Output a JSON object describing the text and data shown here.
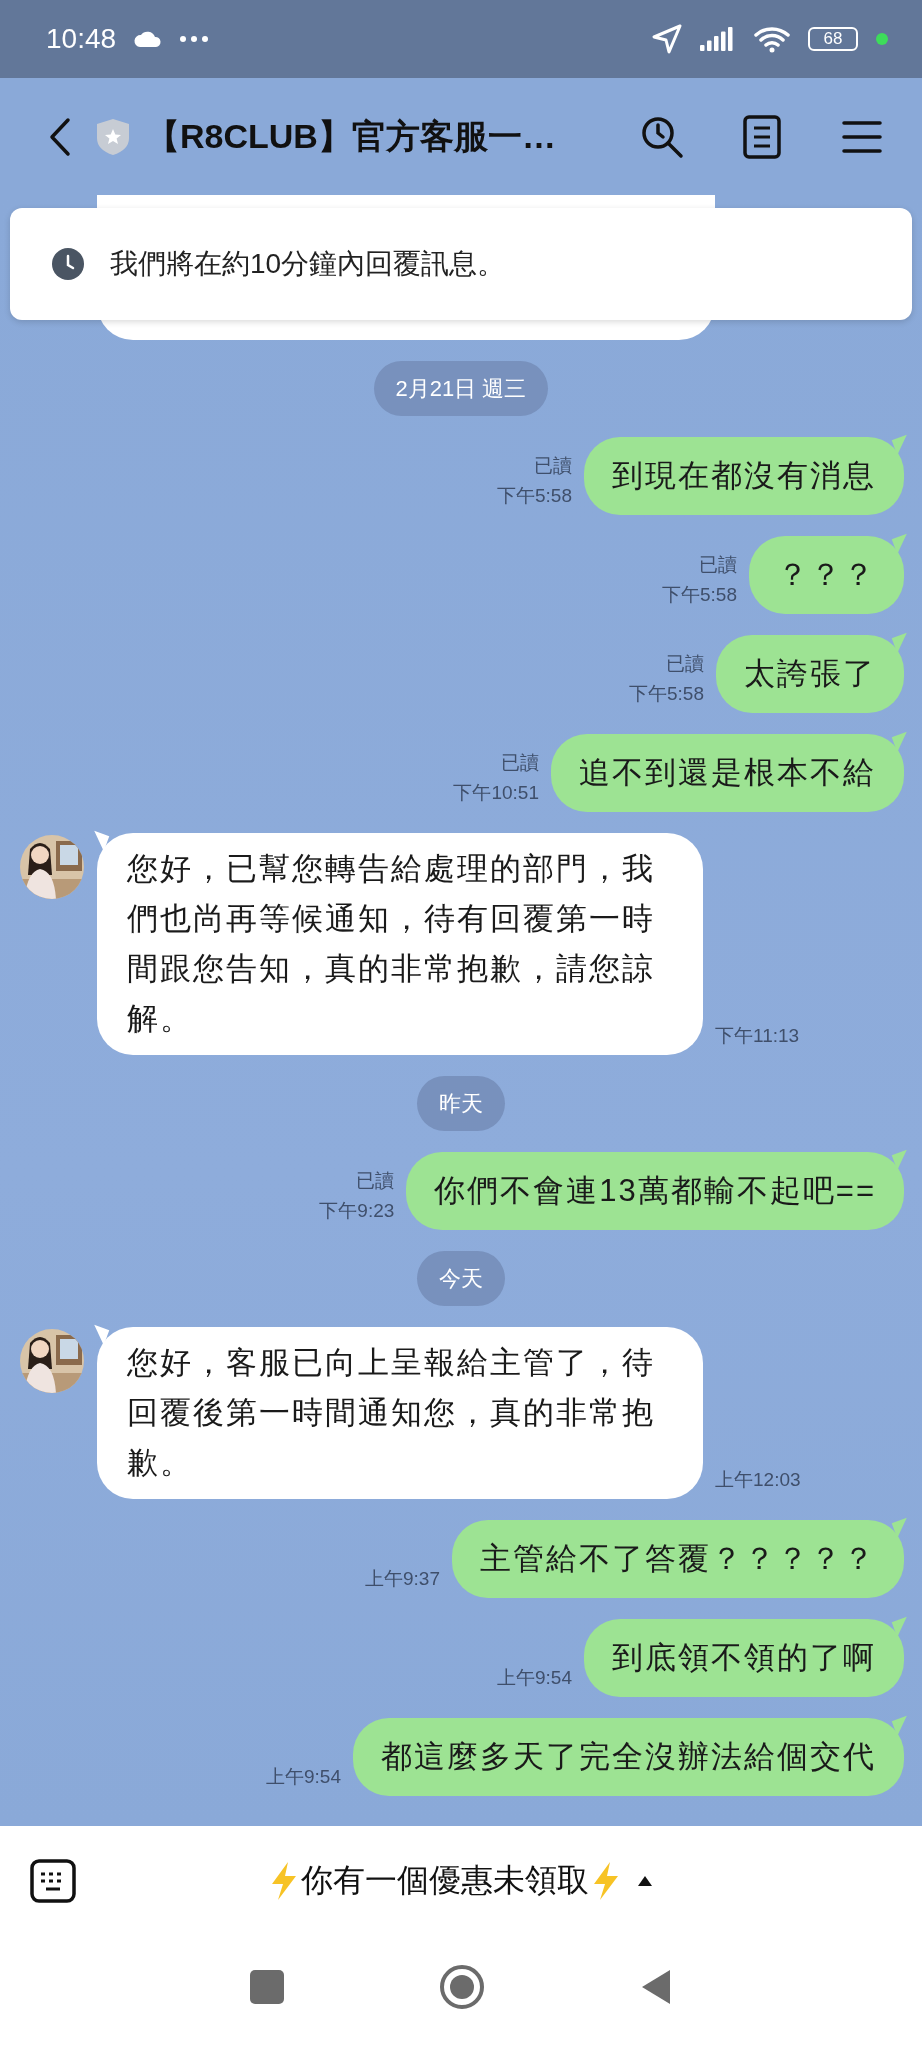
{
  "status_bar": {
    "time": "10:48",
    "battery": "68"
  },
  "header": {
    "title": "【R8CLUB】官方客服一…"
  },
  "notice": {
    "text": "我們將在約10分鐘內回覆訊息。"
  },
  "messages": [
    {
      "kind": "clipped"
    },
    {
      "kind": "date",
      "text": "2月21日 週三"
    },
    {
      "kind": "sent",
      "read": "已讀",
      "time": "下午5:58",
      "text": "到現在都沒有消息"
    },
    {
      "kind": "sent",
      "read": "已讀",
      "time": "下午5:58",
      "text": "？？？"
    },
    {
      "kind": "sent",
      "read": "已讀",
      "time": "下午5:58",
      "text": "太誇張了"
    },
    {
      "kind": "sent",
      "read": "已讀",
      "time": "下午10:51",
      "text": "追不到還是根本不給"
    },
    {
      "kind": "received",
      "text": "您好，已幫您轉告給處理的部門，我們也尚再等候通知，待有回覆第一時間跟您告知，真的非常抱歉，請您諒解。",
      "time": "下午11:13"
    },
    {
      "kind": "date",
      "text": "昨天"
    },
    {
      "kind": "sent",
      "read": "已讀",
      "time": "下午9:23",
      "text": "你們不會連13萬都輸不起吧=="
    },
    {
      "kind": "date",
      "text": "今天"
    },
    {
      "kind": "received",
      "text": "您好，客服已向上呈報給主管了，待回覆後第一時間通知您，真的非常抱歉。",
      "time": "上午12:03"
    },
    {
      "kind": "sent",
      "time": "上午9:37",
      "text": "主管給不了答覆？？？？？"
    },
    {
      "kind": "sent",
      "time": "上午9:54",
      "text": "到底領不領的了啊"
    },
    {
      "kind": "sent",
      "time": "上午9:54",
      "text": "都這麼多天了完全沒辦法給個交代"
    }
  ],
  "menu_bar": {
    "label": "你有一個優惠未領取"
  }
}
